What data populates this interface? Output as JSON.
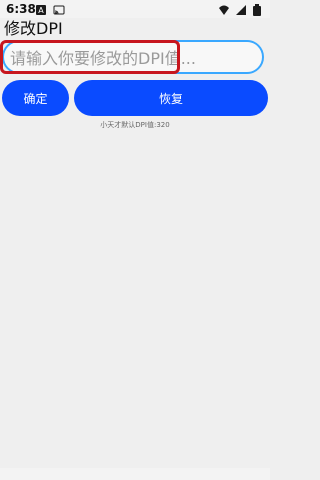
{
  "status_bar": {
    "time": "6:38",
    "left_icons": [
      "app-a-icon",
      "cast-icon"
    ],
    "right_icons": [
      "wifi-icon",
      "signal-icon",
      "battery-icon"
    ]
  },
  "header": {
    "title": "修改DPI"
  },
  "input": {
    "placeholder": "请输入你要修改的DPI值...",
    "value": ""
  },
  "buttons": {
    "confirm_label": "确定",
    "restore_label": "恢复"
  },
  "hint": {
    "text": "小天才默认DPI值:320"
  },
  "colors": {
    "primary": "#0a4bff",
    "input_border": "#3aa8ff",
    "highlight": "#c7161e",
    "background": "#efefef"
  }
}
